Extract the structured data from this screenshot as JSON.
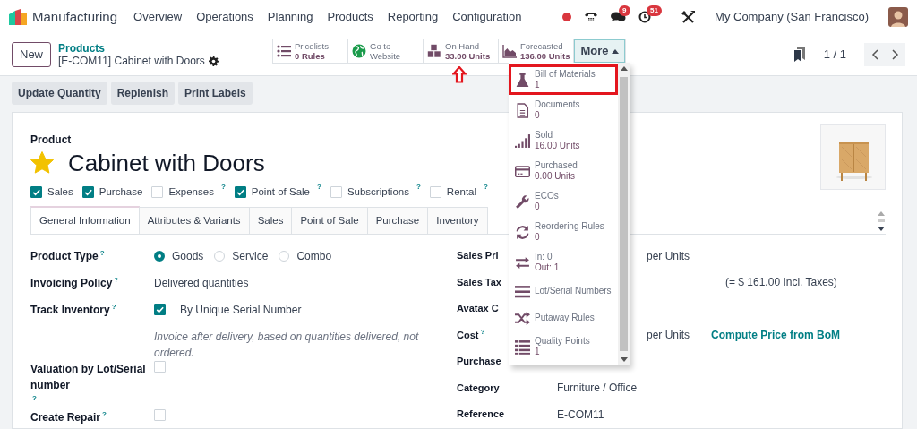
{
  "app": {
    "name": "Manufacturing"
  },
  "menu": [
    "Overview",
    "Operations",
    "Planning",
    "Products",
    "Reporting",
    "Configuration"
  ],
  "systray": {
    "chat_count": "9",
    "activity_count": "51",
    "company": "My Company (San Francisco)"
  },
  "control_panel": {
    "new_button": "New",
    "breadcrumb": "Products",
    "record": "[E-COM11] Cabinet with Doors",
    "pager": "1 / 1"
  },
  "stat_buttons": [
    {
      "kind": "list",
      "title": "Pricelists",
      "value": "0 Rules"
    },
    {
      "kind": "globe",
      "title": "Go to",
      "subtitle": "Website"
    },
    {
      "kind": "boxes",
      "title": "On Hand",
      "value": "33.00 Units"
    },
    {
      "kind": "area",
      "title": "Forecasted",
      "value": "136.00 Units"
    }
  ],
  "more_button": {
    "label": "More",
    "expanded": true
  },
  "actions": [
    "Update Quantity",
    "Replenish",
    "Print Labels"
  ],
  "form": {
    "label": "Product",
    "name": "Cabinet with Doors",
    "favorite": true,
    "options": [
      {
        "label": "Sales",
        "checked": true
      },
      {
        "label": "Purchase",
        "checked": true
      },
      {
        "label": "Expenses",
        "checked": false,
        "help": "?"
      },
      {
        "label": "Point of Sale",
        "checked": true,
        "help": "?"
      },
      {
        "label": "Subscriptions",
        "checked": false,
        "help": "?"
      },
      {
        "label": "Rental",
        "checked": false,
        "help": "?"
      }
    ],
    "tabs": [
      {
        "label": "General Information",
        "selected": true
      },
      {
        "label": "Attributes & Variants",
        "selected": false
      },
      {
        "label": "Sales",
        "selected": false
      },
      {
        "label": "Point of Sale",
        "selected": false
      },
      {
        "label": "Purchase",
        "selected": false
      },
      {
        "label": "Inventory",
        "selected": false
      }
    ],
    "left_fields": [
      {
        "kind": "radio",
        "label": "Product Type",
        "help": "?",
        "options": [
          {
            "label": "Goods",
            "selected": true
          },
          {
            "label": "Service",
            "selected": false
          },
          {
            "label": "Combo",
            "selected": false
          }
        ]
      },
      {
        "kind": "text",
        "label": "Invoicing Policy",
        "help": "?",
        "value": "Delivered quantities"
      },
      {
        "kind": "checkbox",
        "label": "Track Inventory",
        "help": "?",
        "checked": true,
        "value": "By Unique Serial Number"
      },
      {
        "kind": "note",
        "value": "Invoice after delivery, based on quantities delivered, not ordered."
      },
      {
        "kind": "checkbox",
        "label": "Valuation by Lot/Serial number",
        "help": "?",
        "checked": false
      },
      {
        "kind": "checkbox",
        "label": "Create Repair",
        "help": "?",
        "checked": false
      }
    ],
    "right_fields": [
      {
        "kind": "unit",
        "label": "Sales Pri",
        "value": "per Units"
      },
      {
        "kind": "tax",
        "label": "Sales Tax",
        "value": "(= $ 161.00 Incl. Taxes)"
      },
      {
        "kind": "empty",
        "label": "Avatax C"
      },
      {
        "kind": "unit",
        "label": "Cost",
        "help": "?",
        "value": "per Units",
        "link": "Compute Price from BoM"
      },
      {
        "kind": "empty",
        "label": "Purchase"
      },
      {
        "kind": "text",
        "label": "Category",
        "value": "Furniture / Office"
      },
      {
        "kind": "text",
        "label": "Reference",
        "value": "E-COM11"
      }
    ]
  },
  "dropdown": {
    "items": [
      {
        "kind": "flask",
        "title": "Bill of Materials",
        "value": "1",
        "highlighted": true
      },
      {
        "kind": "doc",
        "title": "Documents",
        "value": "0",
        "highlighted": false
      },
      {
        "kind": "signal",
        "title": "Sold",
        "value": "16.00 Units",
        "highlighted": false
      },
      {
        "kind": "card",
        "title": "Purchased",
        "value": "0.00 Units",
        "highlighted": false
      },
      {
        "kind": "wrench",
        "title": "ECOs",
        "value": "0",
        "highlighted": false
      },
      {
        "kind": "refresh",
        "title": "Reordering Rules",
        "value": "0",
        "highlighted": false
      },
      {
        "kind": "exchange",
        "title": "In: 0",
        "value": "Out: 1",
        "highlighted": false
      },
      {
        "kind": "bars",
        "title": "Lot/Serial Numbers",
        "highlighted": false
      },
      {
        "kind": "shuffle",
        "title": "Putaway Rules",
        "highlighted": false
      },
      {
        "kind": "listdots",
        "title": "Quality Points",
        "value": "1",
        "highlighted": false
      }
    ]
  }
}
